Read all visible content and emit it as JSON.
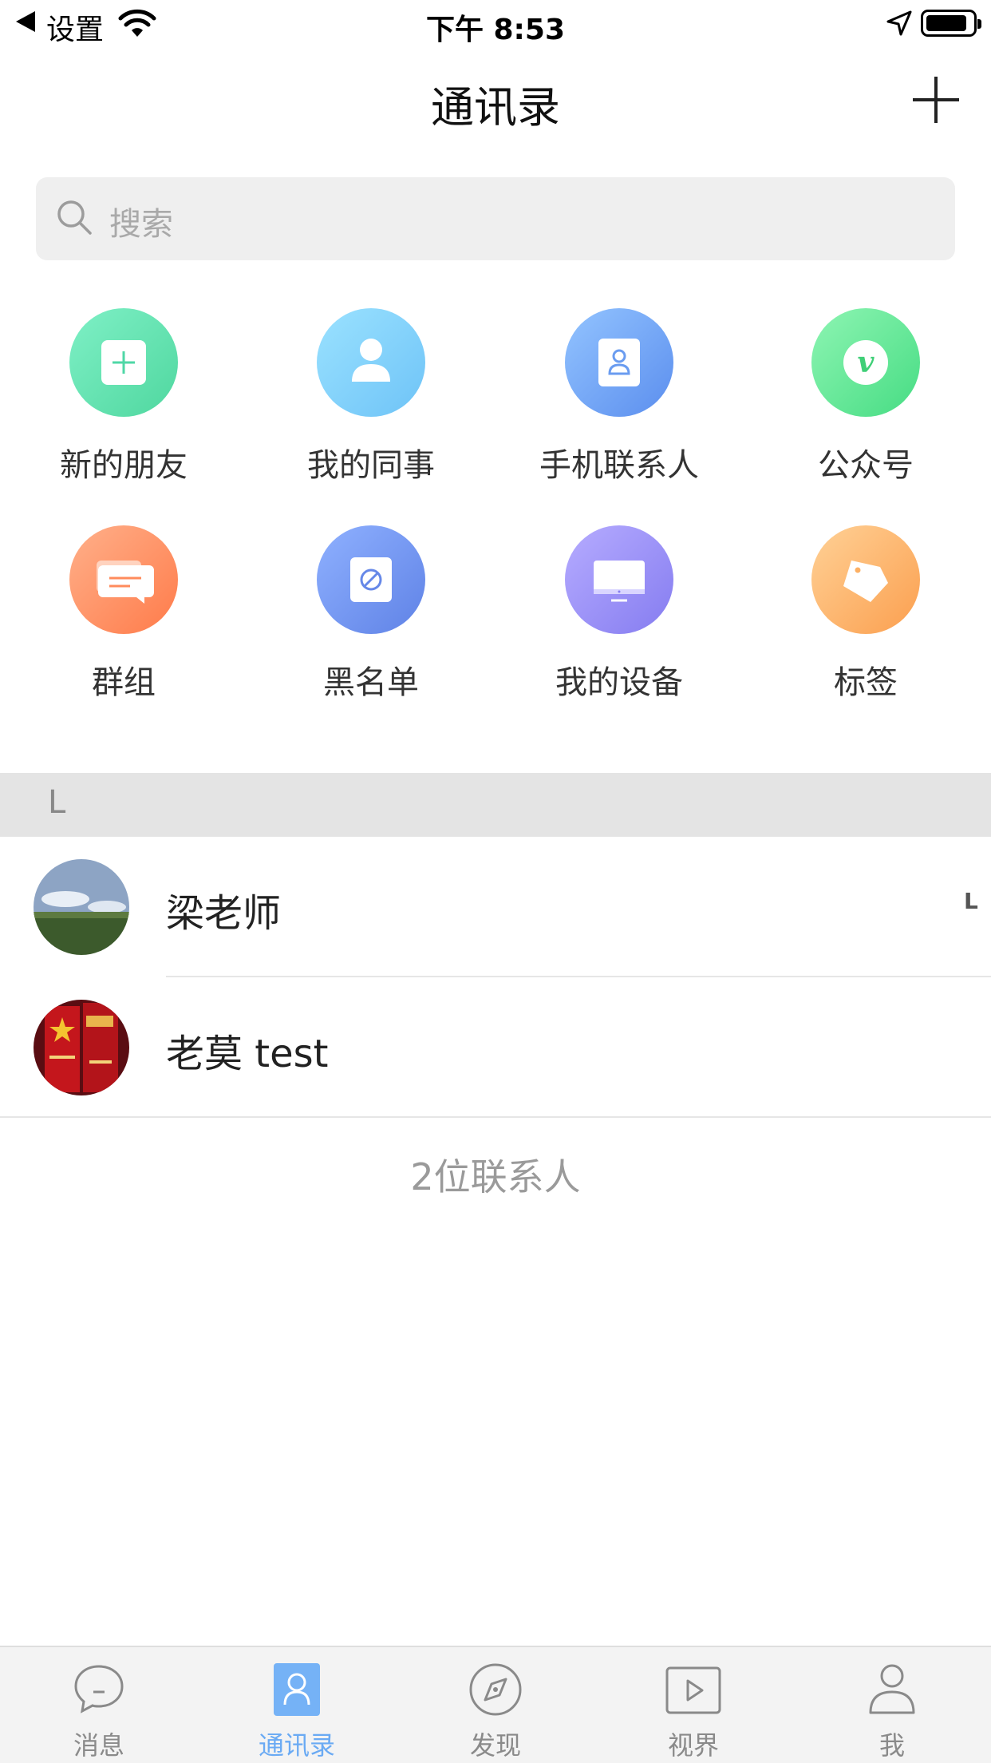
{
  "status_bar": {
    "back_label": "设置",
    "time": "下午 8:53"
  },
  "nav": {
    "title": "通讯录"
  },
  "search": {
    "placeholder": "搜索"
  },
  "entries": [
    {
      "label": "新的朋友",
      "icon": "add-friend-icon",
      "color": "#5fe0b0"
    },
    {
      "label": "我的同事",
      "icon": "colleague-icon",
      "color": "#7fd0fb"
    },
    {
      "label": "手机联系人",
      "icon": "phone-contacts-icon",
      "color": "#6aa6f5"
    },
    {
      "label": "公众号",
      "icon": "official-account-icon",
      "color": "#5fe39a"
    },
    {
      "label": "群组",
      "icon": "group-chat-icon",
      "color": "#ff9062"
    },
    {
      "label": "黑名单",
      "icon": "blacklist-icon",
      "color": "#6b94ef"
    },
    {
      "label": "我的设备",
      "icon": "device-icon",
      "color": "#9b95f6"
    },
    {
      "label": "标签",
      "icon": "tag-icon",
      "color": "#fdb36c"
    }
  ],
  "section": {
    "letter": "L"
  },
  "index_bar": {
    "letter": "L"
  },
  "contacts": [
    {
      "name": "梁老师"
    },
    {
      "name": "老莫 test"
    }
  ],
  "contact_count": "2位联系人",
  "tabs": [
    {
      "label": "消息",
      "icon": "chat-bubble-icon",
      "active": false
    },
    {
      "label": "通讯录",
      "icon": "contacts-icon",
      "active": true
    },
    {
      "label": "发现",
      "icon": "compass-icon",
      "active": false
    },
    {
      "label": "视界",
      "icon": "video-play-icon",
      "active": false
    },
    {
      "label": "我",
      "icon": "profile-icon",
      "active": false
    }
  ],
  "colors": {
    "accent": "#6aaaf3",
    "tab_inactive": "#8a8a8a"
  }
}
